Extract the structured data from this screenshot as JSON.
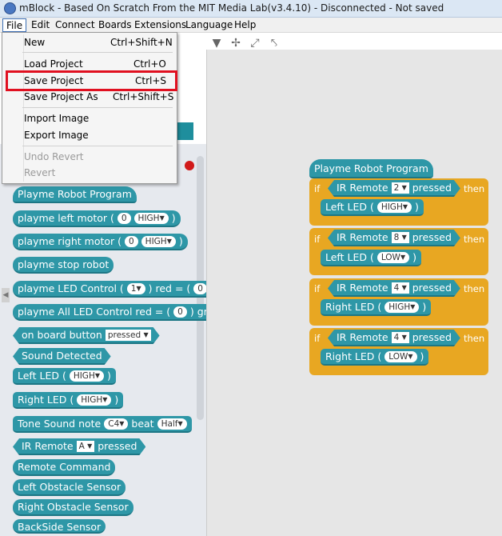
{
  "window": {
    "title": "mBlock - Based On Scratch From the MIT Media Lab(v3.4.10) - Disconnected - Not saved"
  },
  "menubar": {
    "items": [
      "File",
      "Edit",
      "Connect",
      "Boards",
      "Extensions",
      "Language",
      "Help"
    ]
  },
  "toolbar": {
    "icons": [
      "stamp-icon",
      "cut-icon",
      "grow-icon",
      "shrink-icon"
    ]
  },
  "file_menu": {
    "items": [
      {
        "label": "New",
        "shortcut": "Ctrl+Shift+N",
        "enabled": true
      },
      {
        "label": "Load Project",
        "shortcut": "Ctrl+O",
        "enabled": true
      },
      {
        "label": "Save Project",
        "shortcut": "Ctrl+S",
        "enabled": true,
        "highlighted": true
      },
      {
        "label": "Save Project As",
        "shortcut": "Ctrl+Shift+S",
        "enabled": true
      },
      {
        "label": "Import Image",
        "shortcut": "",
        "enabled": true
      },
      {
        "label": "Export Image",
        "shortcut": "",
        "enabled": true
      },
      {
        "label": "Undo Revert",
        "shortcut": "",
        "enabled": false
      },
      {
        "label": "Revert",
        "shortcut": "",
        "enabled": false
      }
    ]
  },
  "palette": {
    "b1": "Playme Robot Program",
    "b2": {
      "text": "playme left motor (",
      "val": "0",
      "sel": "HIGH",
      "end": ")"
    },
    "b3": {
      "text": "playme right motor (",
      "val": "0",
      "sel": "HIGH",
      "end": ")"
    },
    "b4": "playme stop robot",
    "b5": {
      "text": "playme LED Control (",
      "sel": "1",
      "mid": ") red = (",
      "val": "0"
    },
    "b6": {
      "text": "playme All LED Control red = (",
      "val": "0",
      "mid": ") gre"
    },
    "b7": {
      "text": "on board button",
      "sel": "pressed"
    },
    "b8": "Sound Detected",
    "b9": {
      "text": "Left LED (",
      "sel": "HIGH",
      "end": ")"
    },
    "b10": {
      "text": "Right LED (",
      "sel": "HIGH",
      "end": ")"
    },
    "b11": {
      "text": "Tone Sound note",
      "sel1": "C4",
      "mid": "beat",
      "sel2": "Half"
    },
    "b12": {
      "text": "IR Remote",
      "sel": "A",
      "end": "pressed"
    },
    "b13": "Remote Command",
    "b14": "Left Obstacle Sensor",
    "b15": "Right Obstacle Sensor",
    "b16": "BackSide Sensor"
  },
  "script": {
    "hat": "Playme Robot Program",
    "if_label": "if",
    "then_label": "then",
    "ifs": [
      {
        "cond": "IR Remote",
        "key": "2",
        "state": "pressed",
        "action": "Left LED (",
        "level": "HIGH",
        "end": ")"
      },
      {
        "cond": "IR Remote",
        "key": "8",
        "state": "pressed",
        "action": "Left LED (",
        "level": "LOW",
        "end": ")"
      },
      {
        "cond": "IR Remote",
        "key": "4",
        "state": "pressed",
        "action": "Right LED (",
        "level": "HIGH",
        "end": ")"
      },
      {
        "cond": "IR Remote",
        "key": "4",
        "state": "pressed",
        "action": "Right LED (",
        "level": "LOW",
        "end": ")"
      }
    ]
  },
  "colors": {
    "block_teal": "#2e97a7",
    "control_orange": "#e8a722",
    "highlight_red": "#e01020"
  }
}
